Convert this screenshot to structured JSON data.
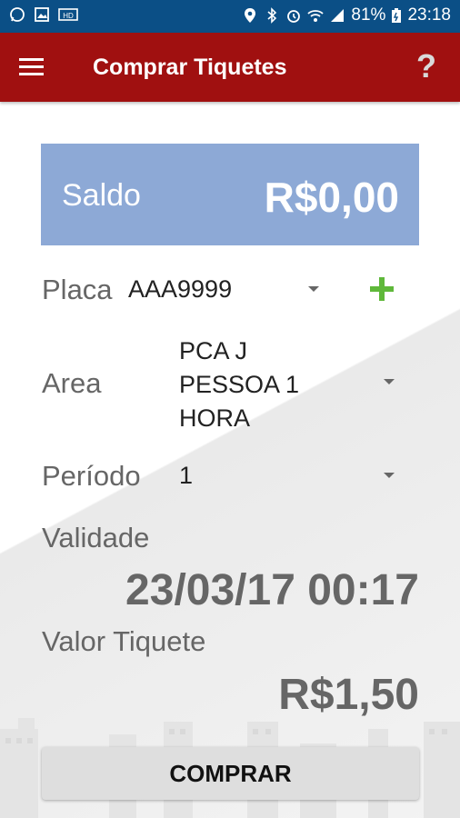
{
  "status_bar": {
    "battery": "81%",
    "time": "23:18",
    "icons": [
      "whatsapp-icon",
      "gallery-icon",
      "hd-icon",
      "location-icon",
      "bluetooth-icon",
      "alarm-icon",
      "wifi-icon",
      "signal-icon",
      "battery-icon"
    ]
  },
  "app_bar": {
    "title": "Comprar Tiquetes",
    "help_label": "?"
  },
  "balance": {
    "label": "Saldo",
    "value": "R$0,00"
  },
  "placa": {
    "label": "Placa",
    "value": "AAA9999"
  },
  "area": {
    "label": "Area",
    "value_lines": [
      "PCA J",
      "PESSOA 1",
      "HORA"
    ]
  },
  "periodo": {
    "label": "Período",
    "value": "1"
  },
  "validade": {
    "label": "Validade",
    "value": "23/03/17 00:17"
  },
  "valor": {
    "label": "Valor Tiquete",
    "value": "R$1,50"
  },
  "buy_button": {
    "label": "COMPRAR"
  },
  "colors": {
    "status_bar": "#0b4f86",
    "app_bar": "#a01010",
    "balance_card": "#8da9d6",
    "add_accent": "#5fb83a"
  }
}
